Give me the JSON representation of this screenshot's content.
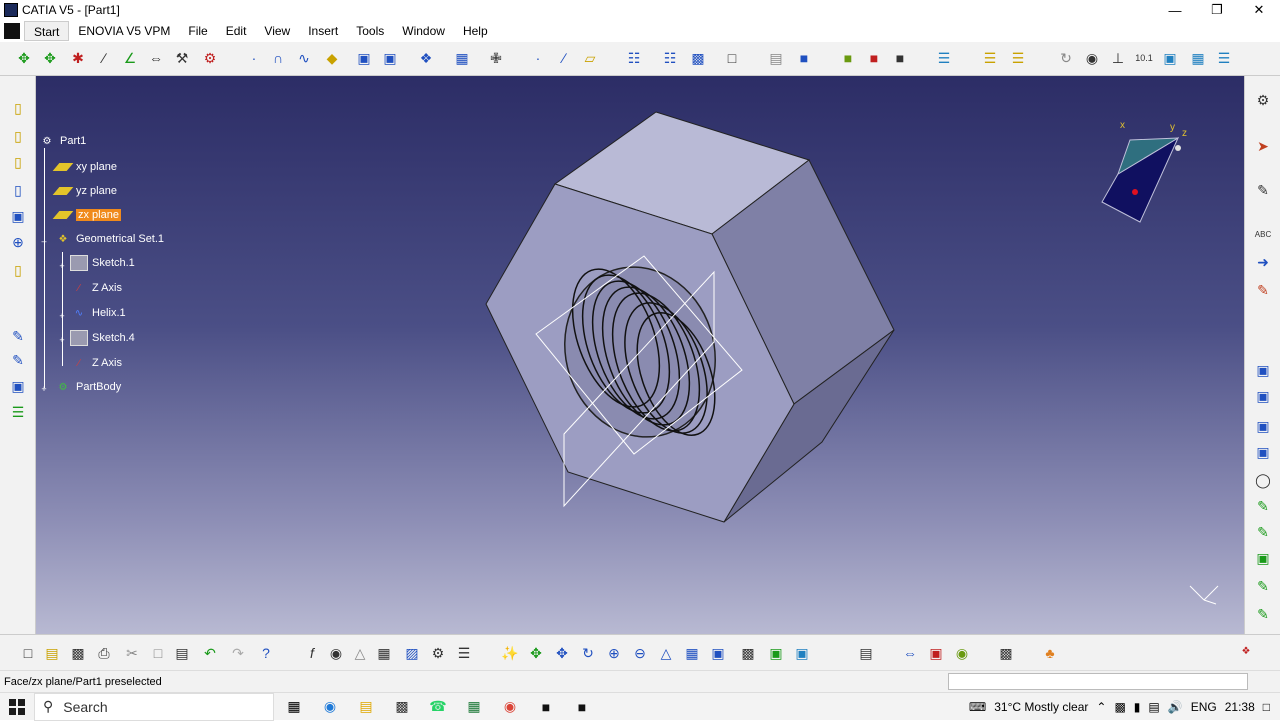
{
  "window": {
    "title": "CATIA V5 - [Part1]"
  },
  "menu": [
    {
      "label": "Start"
    },
    {
      "label": "ENOVIA V5 VPM"
    },
    {
      "label": "File"
    },
    {
      "label": "Edit"
    },
    {
      "label": "View"
    },
    {
      "label": "Insert"
    },
    {
      "label": "Tools"
    },
    {
      "label": "Window"
    },
    {
      "label": "Help"
    }
  ],
  "tree": {
    "root": "Part1",
    "items": [
      {
        "label": "xy plane",
        "type": "plane"
      },
      {
        "label": "yz plane",
        "type": "plane"
      },
      {
        "label": "zx plane",
        "type": "plane",
        "selected": true
      },
      {
        "label": "Geometrical Set.1",
        "type": "geoset"
      },
      {
        "label": "Sketch.1",
        "type": "sketch"
      },
      {
        "label": "Z Axis",
        "type": "axis"
      },
      {
        "label": "Helix.1",
        "type": "helix"
      },
      {
        "label": "Sketch.4",
        "type": "sketch"
      },
      {
        "label": "Z Axis",
        "type": "axis"
      },
      {
        "label": "PartBody",
        "type": "body"
      }
    ]
  },
  "compass_labels": {
    "x": "x",
    "y": "y",
    "z": "z"
  },
  "status": {
    "text": "Face/zx plane/Part1 preselected"
  },
  "taskbar": {
    "search_placeholder": "Search",
    "weather": "31°C Mostly clear",
    "language": "ENG",
    "time": "21:38"
  },
  "colors": {
    "selection": "#f08a1c",
    "viewport_top": "#2c2d66",
    "viewport_bottom": "#b8b9d2",
    "nut_face": "#b7b8d2"
  }
}
